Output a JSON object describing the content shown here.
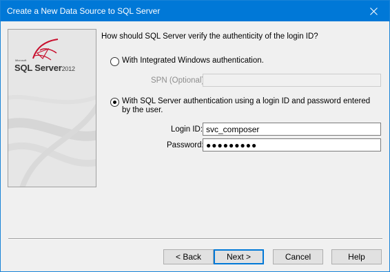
{
  "window": {
    "title": "Create a New Data Source to SQL Server",
    "close_glyph": "✕"
  },
  "sidepanel": {
    "logo_company": "Microsoft",
    "logo_product": "SQL Server",
    "logo_year": "2012",
    "logo_icon": "sql-server-logo-icon"
  },
  "question": "How should SQL Server verify the authenticity of the login ID?",
  "auth": {
    "windows_label": "With Integrated Windows authentication.",
    "windows_selected": false,
    "spn_label": "SPN (Optional):",
    "spn_value": "",
    "sql_label": "With SQL Server authentication using a login ID and password entered by the user.",
    "sql_selected": true
  },
  "credentials": {
    "login_label": "Login ID:",
    "login_value": "svc_composer",
    "password_label": "Password:",
    "password_value": "●●●●●●●●●"
  },
  "buttons": {
    "back": "< Back",
    "next": "Next >",
    "cancel": "Cancel",
    "help": "Help"
  },
  "colors": {
    "titlebar": "#0078d7",
    "default_button_border": "#0078d7"
  }
}
